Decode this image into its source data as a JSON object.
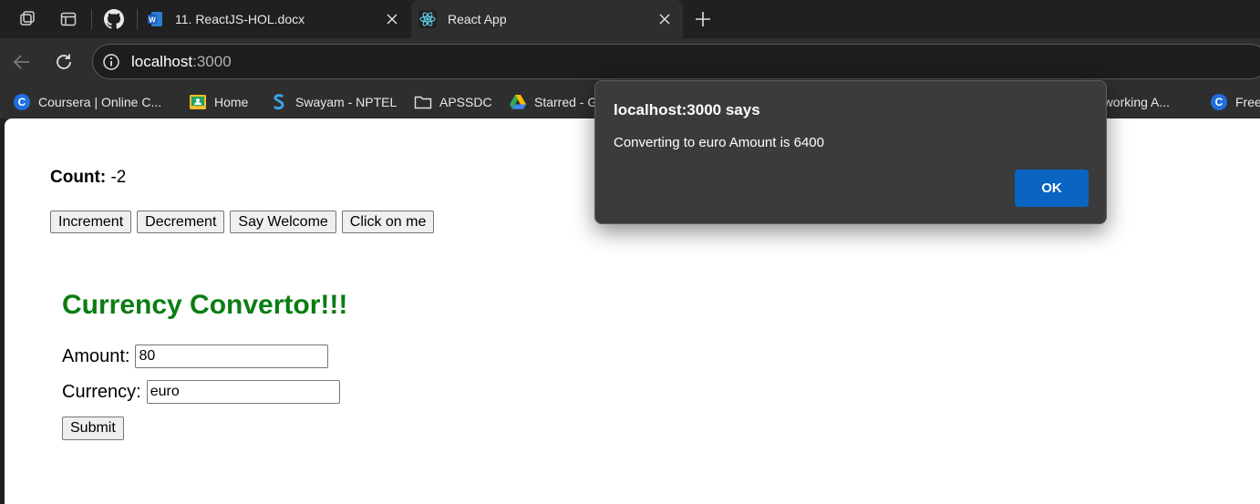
{
  "tabs": [
    {
      "title": "11. ReactJS-HOL.docx",
      "favicon": "word-icon",
      "active": false
    },
    {
      "title": "React App",
      "favicon": "react-icon",
      "active": true
    }
  ],
  "address": {
    "host": "localhost",
    "port": ":3000"
  },
  "bookmarks": [
    {
      "label": "Coursera | Online C...",
      "icon": "coursera-icon"
    },
    {
      "label": "Home",
      "icon": "classroom-icon"
    },
    {
      "label": "Swayam - NPTEL",
      "icon": "swayam-icon"
    },
    {
      "label": "APSSDC",
      "icon": "folder-icon"
    },
    {
      "label": "Starred - G",
      "icon": "google-drive-icon"
    },
    {
      "label": "etworking A...",
      "icon": ""
    },
    {
      "label": "Free",
      "icon": "coursera-icon"
    }
  ],
  "page": {
    "count_label": "Count:",
    "count_value": "-2",
    "buttons": [
      "Increment",
      "Decrement",
      "Say Welcome",
      "Click on me"
    ],
    "converter_title": "Currency Convertor!!!",
    "amount_label": "Amount:",
    "amount_value": "80",
    "currency_label": "Currency:",
    "currency_value": "euro",
    "submit_label": "Submit"
  },
  "dialog": {
    "title": "localhost:3000 says",
    "message": "Converting to euro Amount is 6400",
    "ok_label": "OK"
  },
  "colors": {
    "heading_green": "#0a7d12",
    "ok_button_blue": "#0a64c2",
    "chrome_dark": "#202020"
  }
}
